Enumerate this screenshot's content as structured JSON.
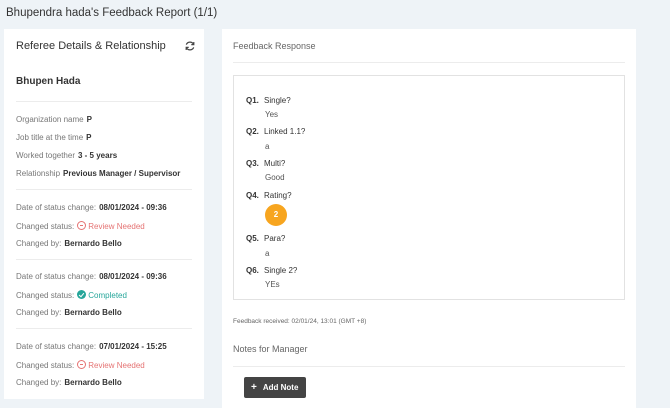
{
  "page_title": "Bhupendra hada's Feedback Report (1/1)",
  "left": {
    "header": "Referee Details & Relationship",
    "person": "Bhupen Hada",
    "details": [
      {
        "label": "Organization name",
        "value": "P"
      },
      {
        "label": "Job title at the time",
        "value": "P"
      },
      {
        "label": "Worked together",
        "value": "3 - 5 years"
      },
      {
        "label": "Relationship",
        "value": "Previous Manager / Supervisor"
      }
    ],
    "history": [
      {
        "date_label": "Date of status change:",
        "date": "08/01/2024 - 09:36",
        "status_label": "Changed status:",
        "status": "Review Needed",
        "status_color": "#e57373",
        "by_label": "Changed by:",
        "by": "Bernardo Bello"
      },
      {
        "date_label": "Date of status change:",
        "date": "08/01/2024 - 09:36",
        "status_label": "Changed status:",
        "status": "Completed",
        "status_color": "#26a69a",
        "by_label": "Changed by:",
        "by": "Bernardo Bello"
      },
      {
        "date_label": "Date of status change:",
        "date": "07/01/2024 - 15:25",
        "status_label": "Changed status:",
        "status": "Review Needed",
        "status_color": "#e57373",
        "by_label": "Changed by:",
        "by": "Bernardo Bello"
      }
    ]
  },
  "right": {
    "header": "Feedback Response",
    "questions": [
      {
        "num": "Q1.",
        "text": "Single?",
        "answer": "Yes"
      },
      {
        "num": "Q2.",
        "text": "Linked 1.1?",
        "answer": "a"
      },
      {
        "num": "Q3.",
        "text": "Multi?",
        "answer": "Good"
      },
      {
        "num": "Q4.",
        "text": "Rating?",
        "answer": "2"
      },
      {
        "num": "Q5.",
        "text": "Para?",
        "answer": "a"
      },
      {
        "num": "Q6.",
        "text": "Single 2?",
        "answer": "YEs"
      }
    ],
    "received": "Feedback received: 02/01/24, 13:01 (GMT +8)",
    "notes_header": "Notes for Manager",
    "add_note_label": "Add Note",
    "rating_color": "#f7a51f"
  }
}
